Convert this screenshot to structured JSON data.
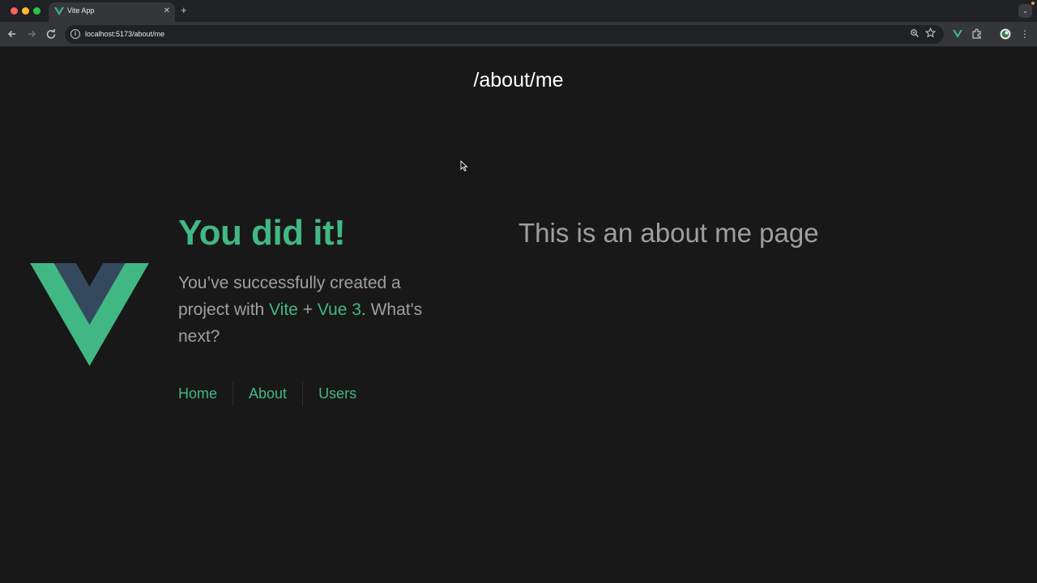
{
  "browser": {
    "tab_title": "Vite App",
    "tab_close": "✕",
    "new_tab": "+",
    "url": "localhost:5173/about/me"
  },
  "page": {
    "route": "/about/me",
    "hero_title": "You did it!",
    "hero_text_1": "You’ve successfully created a project with ",
    "hero_link_vite": "Vite",
    "hero_plus": " + ",
    "hero_link_vue": "Vue 3",
    "hero_text_2": ". What's next?",
    "nav": [
      "Home",
      "About",
      "Users"
    ],
    "about_text": "This is an about me page"
  },
  "colors": {
    "accent": "#42b883",
    "vue_dark": "#35495e",
    "background": "#181818"
  }
}
